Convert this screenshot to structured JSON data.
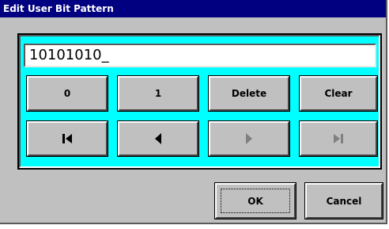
{
  "dialog": {
    "title": "Edit User Bit Pattern"
  },
  "input": {
    "value": "10101010_"
  },
  "keys": {
    "zero": "0",
    "one": "1",
    "delete": "Delete",
    "clear": "Clear"
  },
  "navigation": {
    "first": "jump-to-start-icon",
    "left": "arrow-left-icon",
    "right": "arrow-right-icon",
    "last": "jump-to-end-icon"
  },
  "footer": {
    "ok": "OK",
    "cancel": "Cancel"
  },
  "colors": {
    "titlebar": "#000080",
    "panel": "#00ffff",
    "face": "#c0c0c0"
  }
}
